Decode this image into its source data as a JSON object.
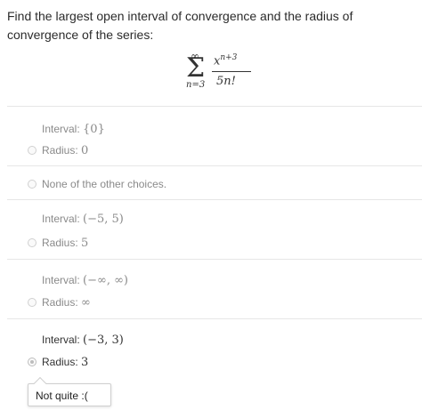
{
  "question": {
    "prompt": "Find the largest open interval of convergence and the radius of convergence of the series:",
    "series": {
      "upper": "∞",
      "sigma": "Σ",
      "lower": "n=3",
      "numerator_base": "x",
      "numerator_exp": "n+3",
      "denominator": "5n!"
    }
  },
  "choices": [
    {
      "interval_label": "Interval:",
      "interval_value": "{0}",
      "radius_label": "Radius:",
      "radius_value": "0",
      "selected": false
    },
    {
      "text": "None of the other choices.",
      "selected": false
    },
    {
      "interval_label": "Interval:",
      "interval_value": "(−5, 5)",
      "radius_label": "Radius:",
      "radius_value": "5",
      "selected": false
    },
    {
      "interval_label": "Interval:",
      "interval_value": "(−∞, ∞)",
      "radius_label": "Radius:",
      "radius_value": "∞",
      "selected": false
    },
    {
      "interval_label": "Interval:",
      "interval_value": "(−3, 3)",
      "radius_label": "Radius:",
      "radius_value": "3",
      "selected": true
    }
  ],
  "feedback": {
    "text": "Not quite :("
  }
}
